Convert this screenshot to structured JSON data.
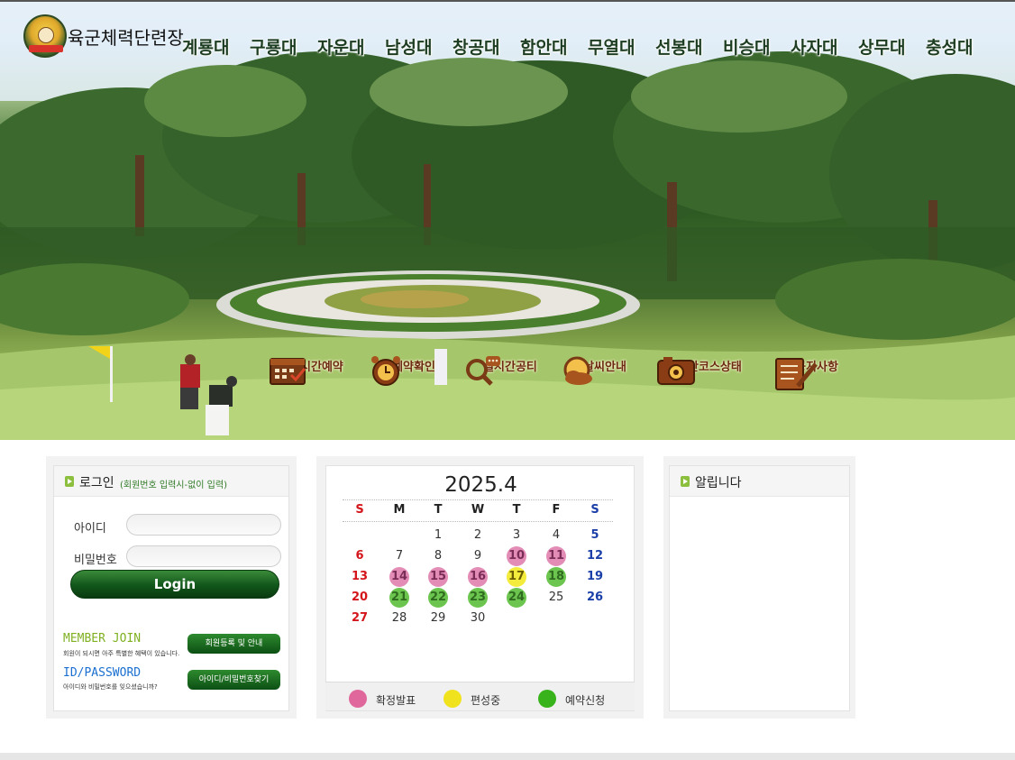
{
  "header": {
    "site_title": "육군체력단련장",
    "nav": [
      "계룡대",
      "구룡대",
      "자운대",
      "남성대",
      "창공대",
      "함안대",
      "무열대",
      "선봉대",
      "비승대",
      "사자대",
      "상무대",
      "충성대"
    ]
  },
  "quick_menu": [
    {
      "label": "실시간예약",
      "icon": "calendar-check-icon"
    },
    {
      "label": "예약확인",
      "icon": "alarm-clock-icon"
    },
    {
      "label": "실시간공티",
      "icon": "magnifier-chat-icon"
    },
    {
      "label": "날씨안내",
      "icon": "sun-cloud-icon"
    },
    {
      "label": "실시간코스상태",
      "icon": "camera-icon"
    },
    {
      "label": "공지사항",
      "icon": "notepad-pen-icon"
    }
  ],
  "login": {
    "title": "로그인",
    "subtitle": "(회원번호 입력시-없이 입력)",
    "id_label": "아이디",
    "pw_label": "비밀번호",
    "login_button": "Login",
    "member_join_title": "MEMBER JOIN",
    "member_join_desc": "회원이 되시면 아주 특별한 혜택이 있습니다.",
    "member_join_button": "회원등록 및 안내",
    "idpw_title": "ID/PASSWORD",
    "idpw_desc": "아이디와 비밀번호를 잊으셨습니까?",
    "idpw_button": "아이디/비밀번호찾기"
  },
  "calendar": {
    "title": "2025.4",
    "weekdays": [
      "S",
      "M",
      "T",
      "W",
      "T",
      "F",
      "S"
    ],
    "rows": [
      [
        "",
        "",
        "1",
        "2",
        "3",
        "4",
        "5"
      ],
      [
        "6",
        "7",
        "8",
        "9",
        "10",
        "11",
        "12"
      ],
      [
        "13",
        "14",
        "15",
        "16",
        "17",
        "18",
        "19"
      ],
      [
        "20",
        "21",
        "22",
        "23",
        "24",
        "25",
        "26"
      ],
      [
        "27",
        "28",
        "29",
        "30",
        "",
        "",
        ""
      ]
    ],
    "status": {
      "10": "pink",
      "11": "pink",
      "14": "pink",
      "15": "pink",
      "16": "pink",
      "17": "yellow",
      "18": "green",
      "21": "green",
      "22": "green",
      "23": "green",
      "24": "green"
    },
    "legend": [
      {
        "label": "확정발표",
        "color": "#e0679c"
      },
      {
        "label": "편성중",
        "color": "#f0e21c"
      },
      {
        "label": "예약신청",
        "color": "#39b31c"
      }
    ],
    "colors": {
      "sunday": "#d4151b",
      "saturday": "#1b3fa8",
      "pink": "#e38cb6",
      "yellow": "#f3ec3c",
      "green": "#6cc54e"
    }
  },
  "notice": {
    "title": "알립니다"
  }
}
